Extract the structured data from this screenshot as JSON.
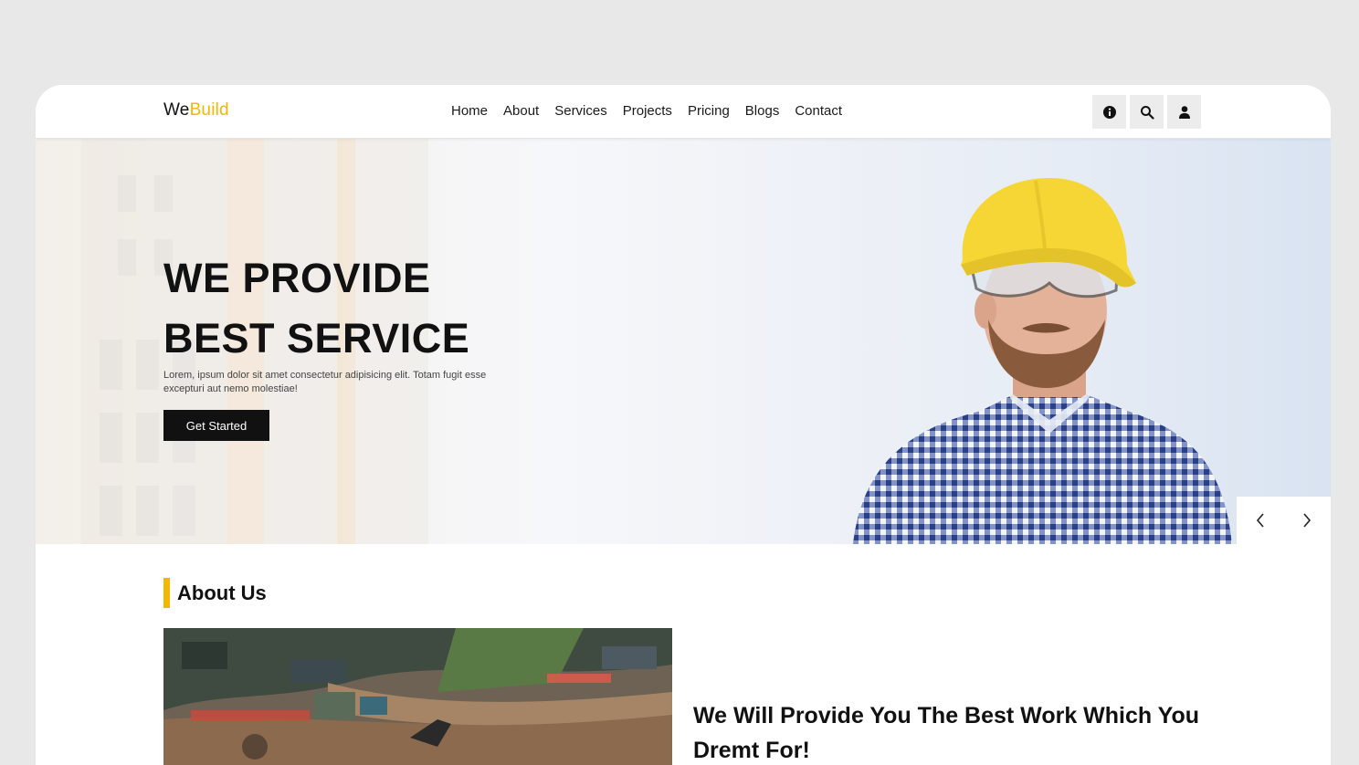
{
  "header": {
    "logo_main": "We",
    "logo_accent": "Build",
    "nav": [
      "Home",
      "About",
      "Services",
      "Projects",
      "Pricing",
      "Blogs",
      "Contact"
    ],
    "icons": [
      "info-icon",
      "search-icon",
      "user-icon"
    ]
  },
  "hero": {
    "title_line1": "WE PROVIDE",
    "title_line2": "BEST SERVICE",
    "text": "Lorem, ipsum dolor sit amet consectetur adipisicing elit. Totam fugit esse excepturi aut nemo molestiae!",
    "cta": "Get Started",
    "prev_icon": "chevron-left-icon",
    "next_icon": "chevron-right-icon"
  },
  "about": {
    "title": "About Us",
    "heading": "We Will Provide You The Best Work Which You Dremt For!"
  },
  "colors": {
    "accent": "#f2b705",
    "dark": "#111111",
    "icon_bg": "#ececec"
  }
}
